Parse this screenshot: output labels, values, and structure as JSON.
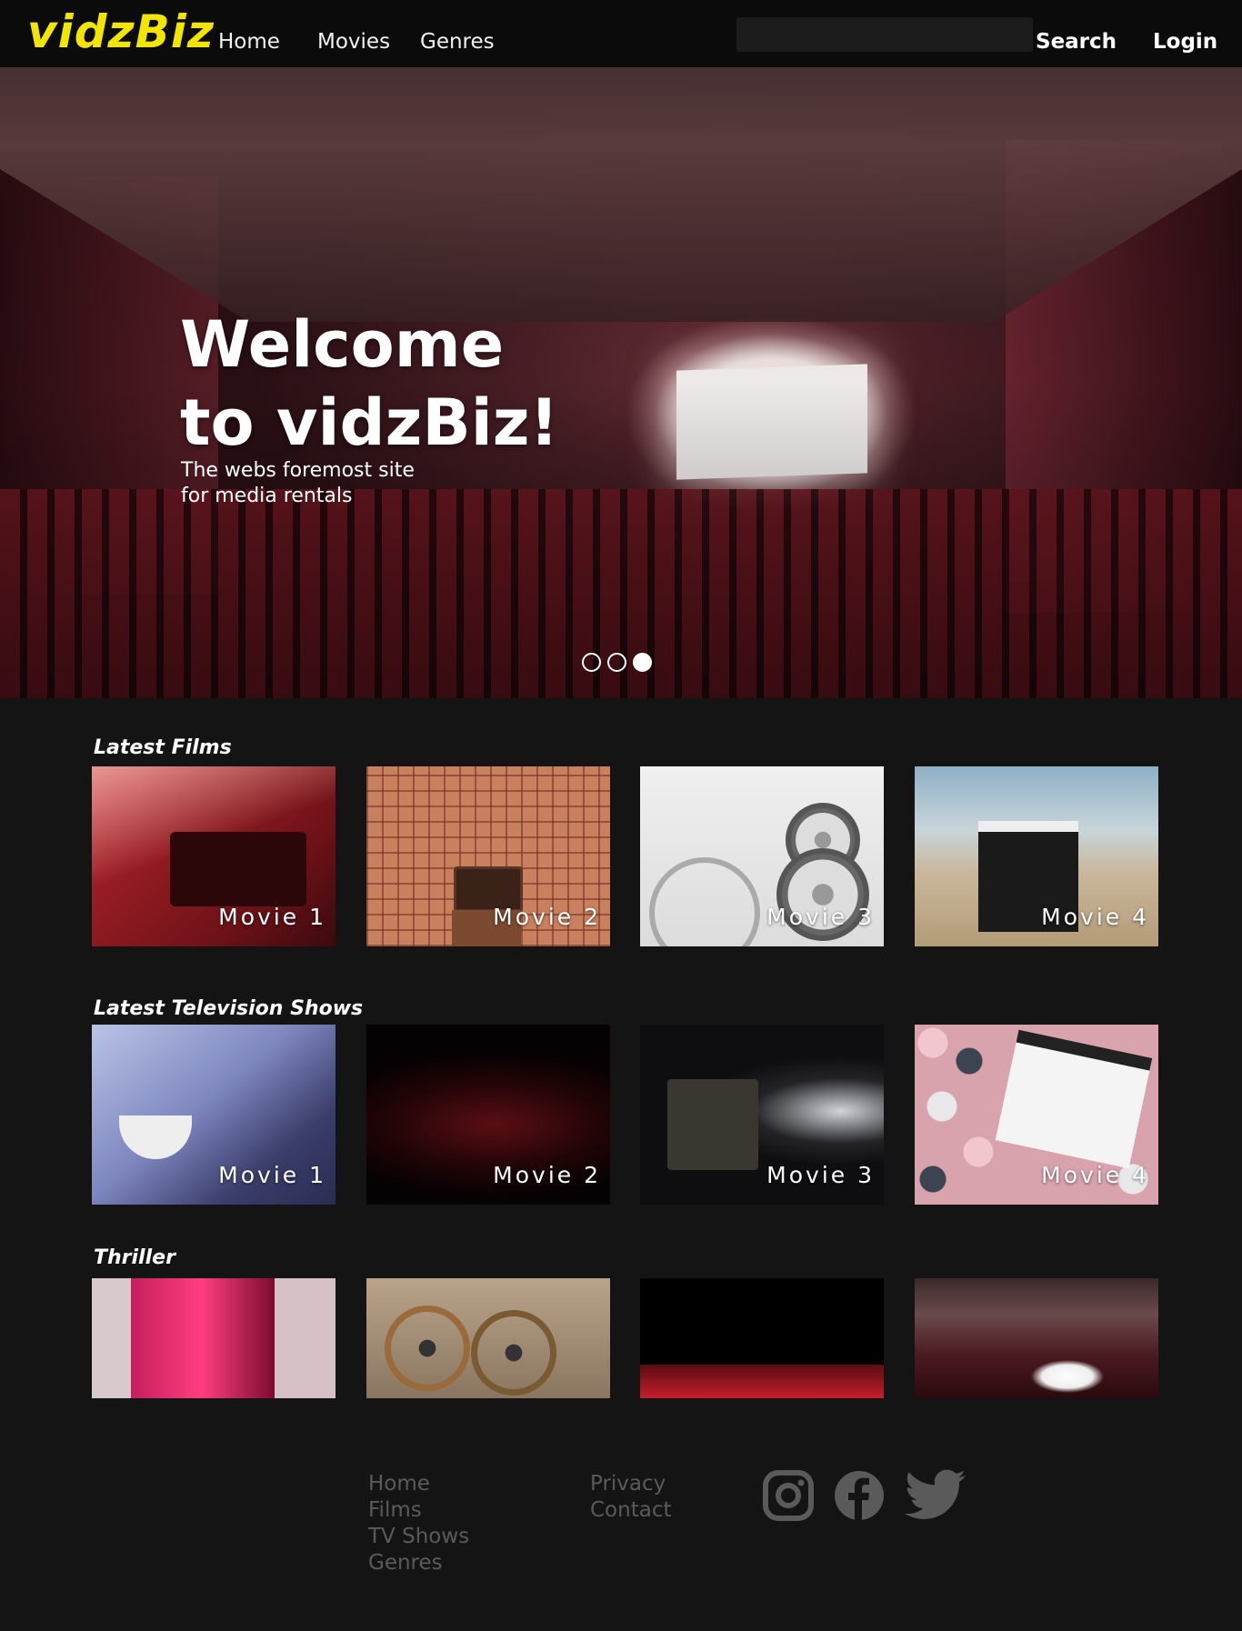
{
  "nav": {
    "logo": "vidzBiz",
    "links": [
      "Home",
      "Movies",
      "Genres"
    ],
    "search_value": "",
    "search_label": "Search",
    "login_label": "Login"
  },
  "hero": {
    "title_line1": "Welcome",
    "title_line2": "to vidzBiz!",
    "subtitle_line1": "The webs foremost site",
    "subtitle_line2": "for media rentals",
    "slide_count": 3,
    "active_slide": 3
  },
  "sections": [
    {
      "title": "Latest Films",
      "cards": [
        "Movie 1",
        "Movie 2",
        "Movie 3",
        "Movie 4"
      ]
    },
    {
      "title": "Latest Television Shows",
      "cards": [
        "Movie 1",
        "Movie 2",
        "Movie 3",
        "Movie 4"
      ]
    },
    {
      "title": "Thriller",
      "cards": [
        "",
        "",
        "",
        ""
      ]
    }
  ],
  "footer": {
    "col1": [
      "Home",
      "Films",
      "TV Shows",
      "Genres"
    ],
    "col2": [
      "Privacy",
      "Contact"
    ],
    "social_icons": [
      "instagram-icon",
      "facebook-icon",
      "twitter-icon"
    ]
  },
  "colors": {
    "brand": "#f2e600",
    "background": "#141414",
    "nav_background": "#0b0b0b",
    "footer_text": "#5a5a5a"
  }
}
